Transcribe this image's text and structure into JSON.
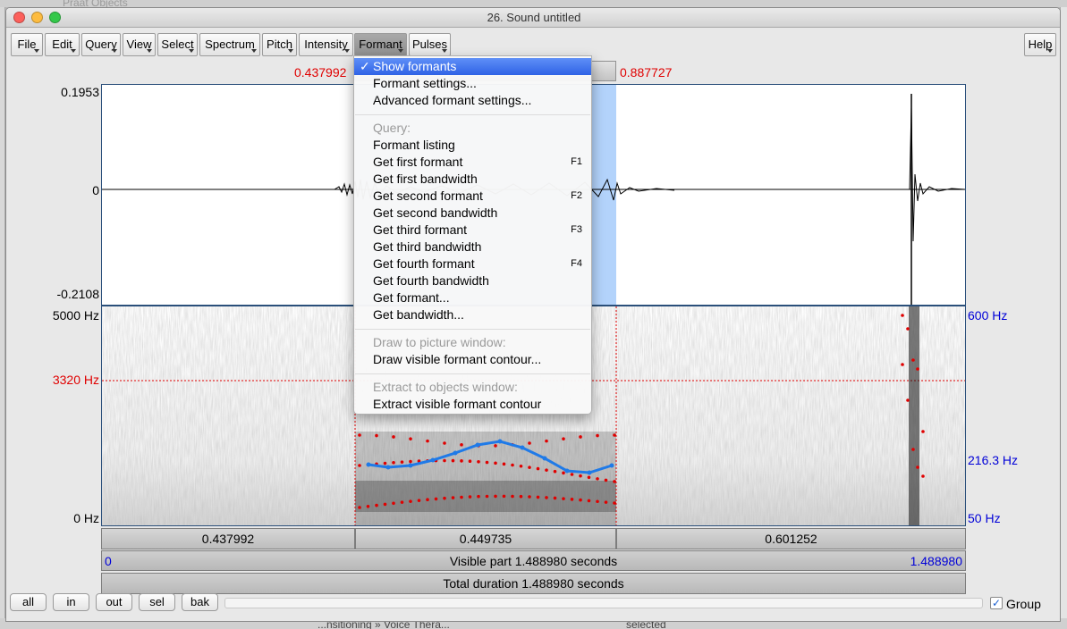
{
  "background": {
    "other_window_title": "Praat Objects",
    "bottom_text_left": "...nsitioning » Voice Thera...",
    "bottom_text_right": "selected"
  },
  "window": {
    "title": "26. Sound untitled"
  },
  "menubar": {
    "items": [
      "File",
      "Edit",
      "Query",
      "View",
      "Select",
      "Spectrum",
      "Pitch",
      "Intensity",
      "Formant",
      "Pulses"
    ],
    "active": "Formant",
    "help": "Help"
  },
  "selection": {
    "start_label": "0.437992",
    "end_label": "0.887727"
  },
  "waveform": {
    "ymax": "0.1953",
    "zero": "0",
    "ymin": "-0.2108"
  },
  "spectrogram": {
    "top_left": "5000 Hz",
    "cursor_freq": "3320 Hz",
    "bottom_left": "0 Hz",
    "pitch_top": "600 Hz",
    "pitch_value": "216.3 Hz",
    "pitch_bottom": "50 Hz"
  },
  "durations": {
    "segment_left": "0.437992",
    "segment_mid": "0.449735",
    "segment_right": "0.601252",
    "visible_start": "0",
    "visible_text": "Visible part 1.488980 seconds",
    "visible_end": "1.488980",
    "total_text": "Total duration 1.488980 seconds"
  },
  "bottom_buttons": [
    "all",
    "in",
    "out",
    "sel",
    "bak"
  ],
  "group": {
    "label": "Group",
    "checked": true
  },
  "formant_menu": {
    "items": [
      {
        "label": "Show formants",
        "checked": true,
        "highlighted": true
      },
      {
        "label": "Formant settings..."
      },
      {
        "label": "Advanced formant settings..."
      },
      {
        "label": "Query:",
        "disabled": true
      },
      {
        "label": "Formant listing"
      },
      {
        "label": "Get first formant",
        "shortcut": "F1"
      },
      {
        "label": "Get first bandwidth"
      },
      {
        "label": "Get second formant",
        "shortcut": "F2"
      },
      {
        "label": "Get second bandwidth"
      },
      {
        "label": "Get third formant",
        "shortcut": "F3"
      },
      {
        "label": "Get third bandwidth"
      },
      {
        "label": "Get fourth formant",
        "shortcut": "F4"
      },
      {
        "label": "Get fourth bandwidth"
      },
      {
        "label": "Get formant..."
      },
      {
        "label": "Get bandwidth..."
      },
      {
        "label": "Draw to picture window:",
        "disabled": true
      },
      {
        "label": "Draw visible formant contour..."
      },
      {
        "label": "Extract to objects window:",
        "disabled": true
      },
      {
        "label": "Extract visible formant contour"
      }
    ]
  },
  "colors": {
    "selection_blue": "#b3d3fb",
    "formant_red": "#e00000",
    "pitch_blue": "#1f7ae8",
    "menu_highlight": "#3a6ff0"
  }
}
